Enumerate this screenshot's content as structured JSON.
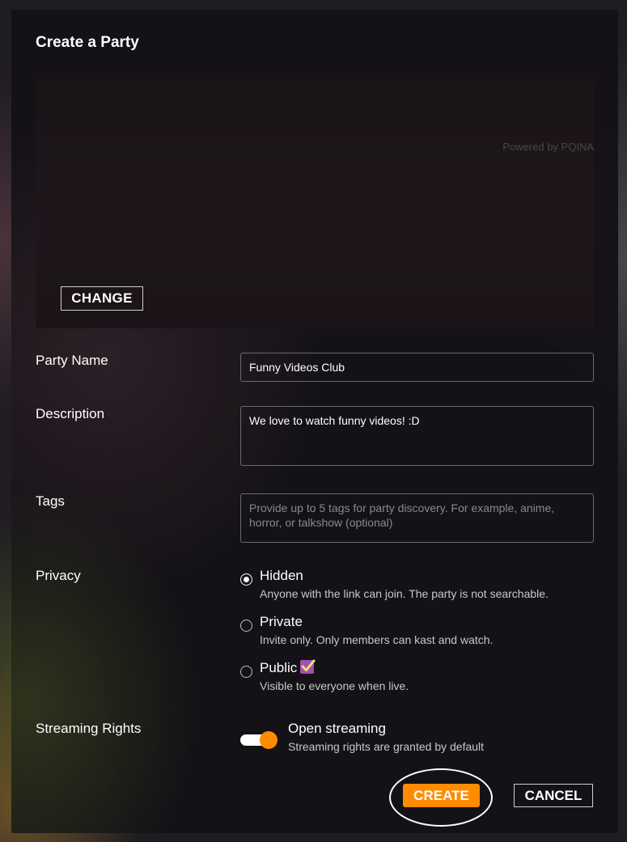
{
  "dialog": {
    "title": "Create a Party",
    "cover": {
      "powered_by": "Powered by PQINA",
      "change_label": "CHANGE"
    }
  },
  "form": {
    "party_name": {
      "label": "Party Name",
      "value": "Funny Videos Club"
    },
    "description": {
      "label": "Description",
      "value": "We love to watch funny videos! :D"
    },
    "tags": {
      "label": "Tags",
      "placeholder": "Provide up to 5 tags for party discovery. For example, anime, horror, or talkshow (optional)"
    },
    "privacy": {
      "label": "Privacy",
      "options": [
        {
          "title": "Hidden",
          "description": "Anyone with the link can join. The party is not searchable.",
          "selected": true
        },
        {
          "title": "Private",
          "description": "Invite only. Only members can kast and watch.",
          "selected": false
        },
        {
          "title": "Public",
          "description": "Visible to everyone when live.",
          "selected": false,
          "icon": "checkbox-check-icon"
        }
      ]
    },
    "streaming_rights": {
      "label": "Streaming Rights",
      "option_title": "Open streaming",
      "option_description": "Streaming rights are granted by default",
      "enabled": true
    }
  },
  "actions": {
    "create_label": "CREATE",
    "cancel_label": "CANCEL"
  },
  "colors": {
    "accent": "#ff8c00",
    "public_badge": "#a24fb2"
  }
}
